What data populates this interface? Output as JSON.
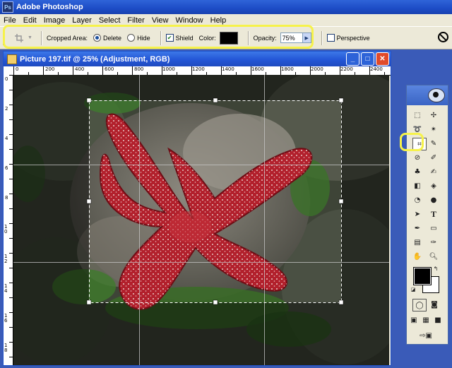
{
  "app": {
    "title": "Adobe Photoshop",
    "logo": "Ps"
  },
  "menu": [
    "File",
    "Edit",
    "Image",
    "Layer",
    "Select",
    "Filter",
    "View",
    "Window",
    "Help"
  ],
  "options": {
    "cropped_area_label": "Cropped Area:",
    "delete_label": "Delete",
    "hide_label": "Hide",
    "shield_label": "Shield",
    "color_label": "Color:",
    "shield_color": "#000000",
    "opacity_label": "Opacity:",
    "opacity_value": "75%",
    "perspective_label": "Perspective"
  },
  "document": {
    "title": "Picture 197.tif @ 25% (Adjustment, RGB)",
    "ruler_h": [
      "0",
      "200",
      "400",
      "600",
      "800",
      "1000",
      "1200",
      "1400",
      "1600",
      "1800",
      "2000",
      "2200",
      "2400"
    ],
    "ruler_v": [
      "0",
      "2",
      "4",
      "6",
      "8",
      "1 0",
      "1 2",
      "1 4",
      "1 6",
      "1 8"
    ]
  },
  "highlight_color": "#f6f24a"
}
